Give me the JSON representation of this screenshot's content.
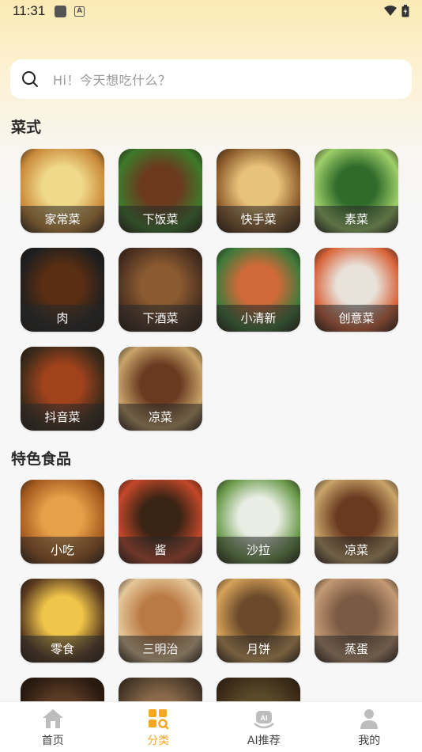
{
  "status_bar": {
    "time": "11:31"
  },
  "search": {
    "placeholder": "Hi！今天想吃什么？"
  },
  "section1": {
    "title": "菜式",
    "items": [
      {
        "label": "家常菜",
        "c1": "#f1d98a",
        "c2": "#c98a3a"
      },
      {
        "label": "下饭菜",
        "c1": "#6b3a1e",
        "c2": "#3d7a2a"
      },
      {
        "label": "快手菜",
        "c1": "#e9c27a",
        "c2": "#8a5a2a"
      },
      {
        "label": "素菜",
        "c1": "#2f6b2a",
        "c2": "#9fcf6a"
      },
      {
        "label": "肉",
        "c1": "#5a2e12",
        "c2": "#1f1f1f"
      },
      {
        "label": "下酒菜",
        "c1": "#8a5a30",
        "c2": "#4a3020"
      },
      {
        "label": "小清新",
        "c1": "#d06a3a",
        "c2": "#3e7a3a"
      },
      {
        "label": "创意菜",
        "c1": "#e8e2da",
        "c2": "#d8643a"
      },
      {
        "label": "抖音菜",
        "c1": "#a0421c",
        "c2": "#3a2a1a"
      },
      {
        "label": "凉菜",
        "c1": "#6a3a20",
        "c2": "#c9a46a"
      }
    ]
  },
  "section2": {
    "title": "特色食品",
    "items": [
      {
        "label": "小吃",
        "c1": "#e7a04a",
        "c2": "#a55a1e"
      },
      {
        "label": "酱",
        "c1": "#3a2414",
        "c2": "#c4482a"
      },
      {
        "label": "沙拉",
        "c1": "#e9eee4",
        "c2": "#6a9a4a"
      },
      {
        "label": "凉菜",
        "c1": "#6a3a20",
        "c2": "#c9a46a"
      },
      {
        "label": "零食",
        "c1": "#f0c64a",
        "c2": "#5a3a20"
      },
      {
        "label": "三明治",
        "c1": "#b97a44",
        "c2": "#e6c89a"
      },
      {
        "label": "月饼",
        "c1": "#6a4a2a",
        "c2": "#d8a35a"
      },
      {
        "label": "蒸蛋",
        "c1": "#7a5a44",
        "c2": "#c49a74"
      },
      {
        "label": "",
        "c1": "#5a3a24",
        "c2": "#2a1a10"
      },
      {
        "label": "",
        "c1": "#8a6a4a",
        "c2": "#4a3a2a"
      },
      {
        "label": "",
        "c1": "#5a4a2a",
        "c2": "#3a2a18"
      }
    ]
  },
  "nav": {
    "home": "首页",
    "category": "分类",
    "ai": "AI推荐",
    "mine": "我的",
    "active_color": "#f5a623"
  }
}
